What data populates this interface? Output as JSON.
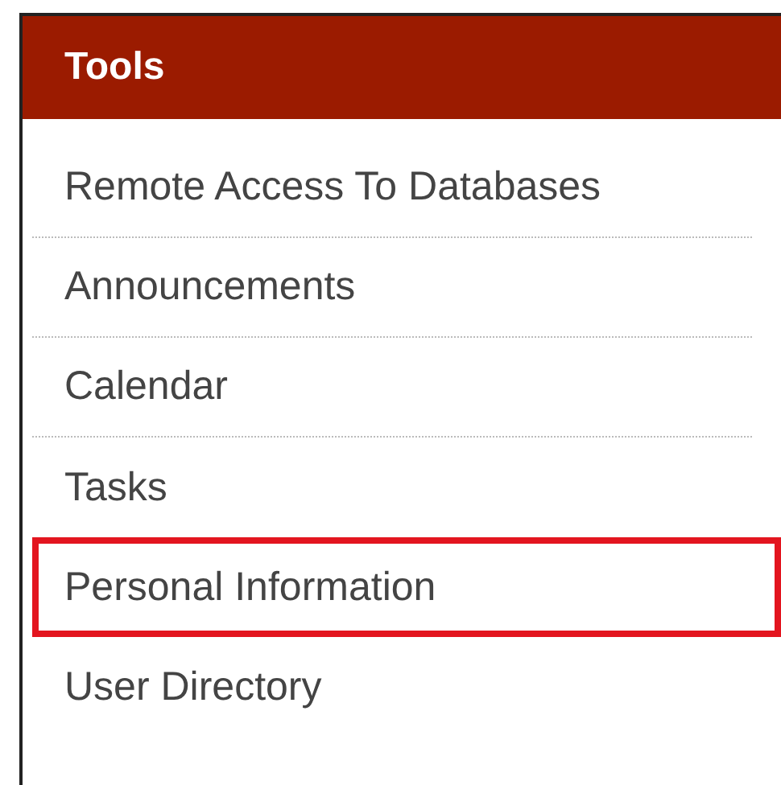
{
  "panel": {
    "title": "Tools"
  },
  "items": [
    {
      "label": "Remote Access To Databases",
      "highlighted": false
    },
    {
      "label": "Announcements",
      "highlighted": false
    },
    {
      "label": "Calendar",
      "highlighted": false
    },
    {
      "label": "Tasks",
      "highlighted": false
    },
    {
      "label": "Personal Information",
      "highlighted": true
    },
    {
      "label": "User Directory",
      "highlighted": false
    }
  ]
}
